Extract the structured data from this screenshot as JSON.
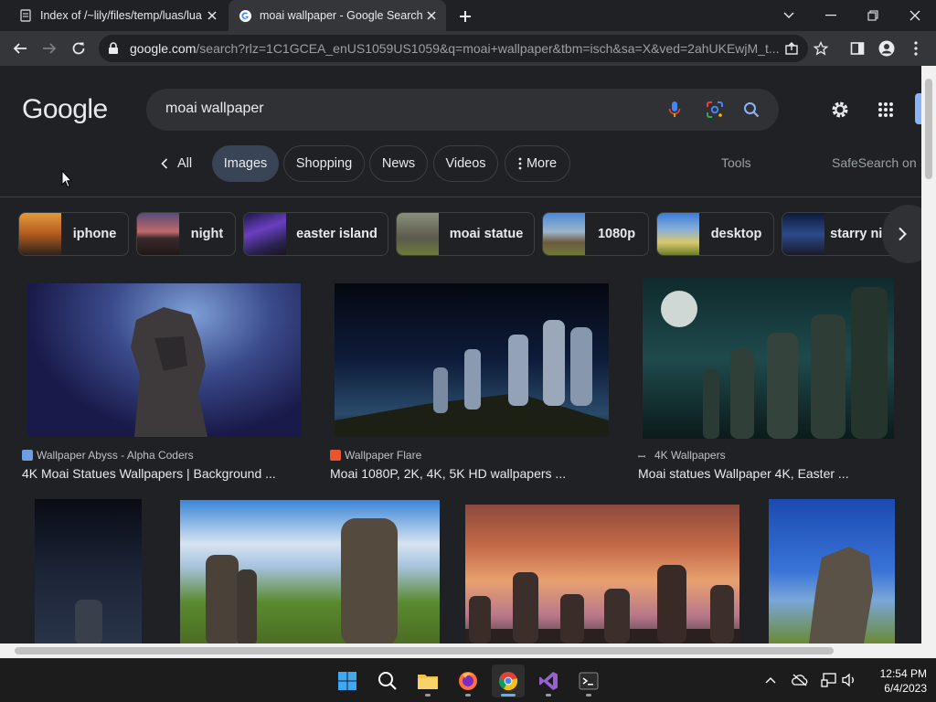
{
  "browser": {
    "tabs": [
      {
        "title": "Index of /~lily/files/temp/luas/lua",
        "active": false
      },
      {
        "title": "moai wallpaper - Google Search",
        "active": true
      }
    ],
    "url_host": "google.com",
    "url_rest": "/search?rlz=1C1GCEA_enUS1059US1059&q=moai+wallpaper&tbm=isch&sa=X&ved=2ahUKEwjM_t..."
  },
  "page": {
    "logo": "Google",
    "query": "moai wallpaper",
    "back_label": "All",
    "tabs": [
      "Images",
      "Shopping",
      "News",
      "Videos",
      "More"
    ],
    "tools_label": "Tools",
    "safesearch_label": "SafeSearch on",
    "chips": [
      {
        "label": "iphone"
      },
      {
        "label": "night"
      },
      {
        "label": "easter island"
      },
      {
        "label": "moai statue"
      },
      {
        "label": "1080p"
      },
      {
        "label": "desktop"
      },
      {
        "label": "starry night"
      }
    ],
    "results": [
      {
        "source": "Wallpaper Abyss - Alpha Coders",
        "title": "4K Moai Statues Wallpapers | Background ..."
      },
      {
        "source": "Wallpaper Flare",
        "title": "Moai 1080P, 2K, 4K, 5K HD wallpapers ..."
      },
      {
        "source": "4K Wallpapers",
        "title": "Moai statues Wallpaper 4K, Easter ..."
      }
    ]
  },
  "taskbar": {
    "time": "12:54 PM",
    "date": "6/4/2023"
  },
  "colors": {
    "page_bg": "#202124",
    "accent_blue": "#8ab4f8",
    "selected_tab_bg": "#394457"
  }
}
